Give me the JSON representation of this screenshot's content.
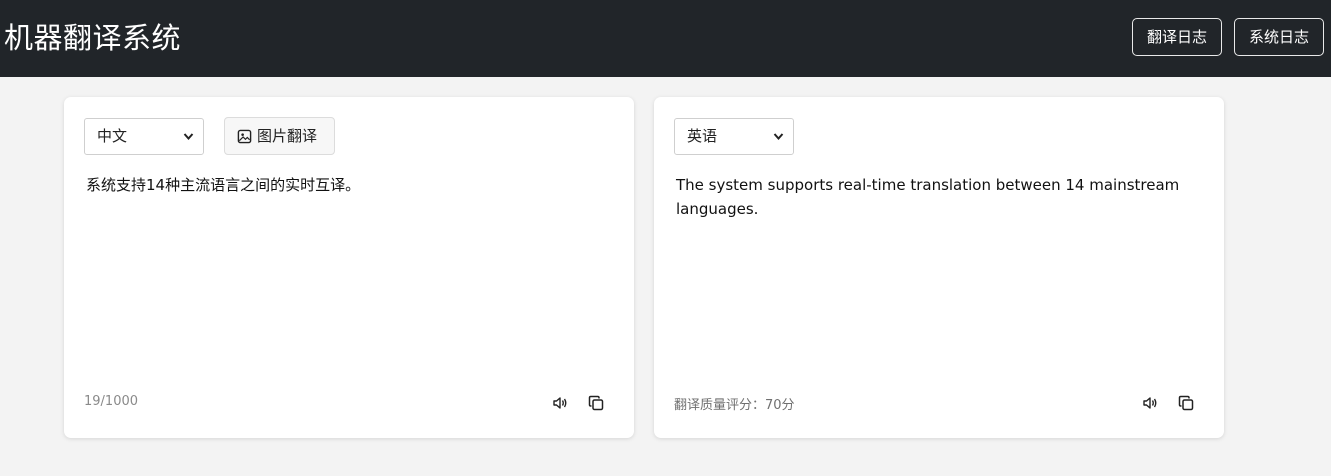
{
  "header": {
    "title": "机器翻译系统",
    "buttons": [
      "翻译日志",
      "系统日志"
    ]
  },
  "source": {
    "language": "中文",
    "image_translate_label": "图片翻译",
    "text": "系统支持14种主流语言之间的实时互译。",
    "char_count": "19/1000"
  },
  "target": {
    "language": "英语",
    "text": "The system supports real-time translation between 14 mainstream languages.",
    "quality_label": "翻译质量评分：70分"
  },
  "icons": {
    "speak": "speaker-icon",
    "copy": "copy-icon",
    "image": "image-icon",
    "dropdown": "chevron-down-icon"
  },
  "colors": {
    "header_bg": "#212529",
    "page_bg": "#f3f3f3"
  }
}
